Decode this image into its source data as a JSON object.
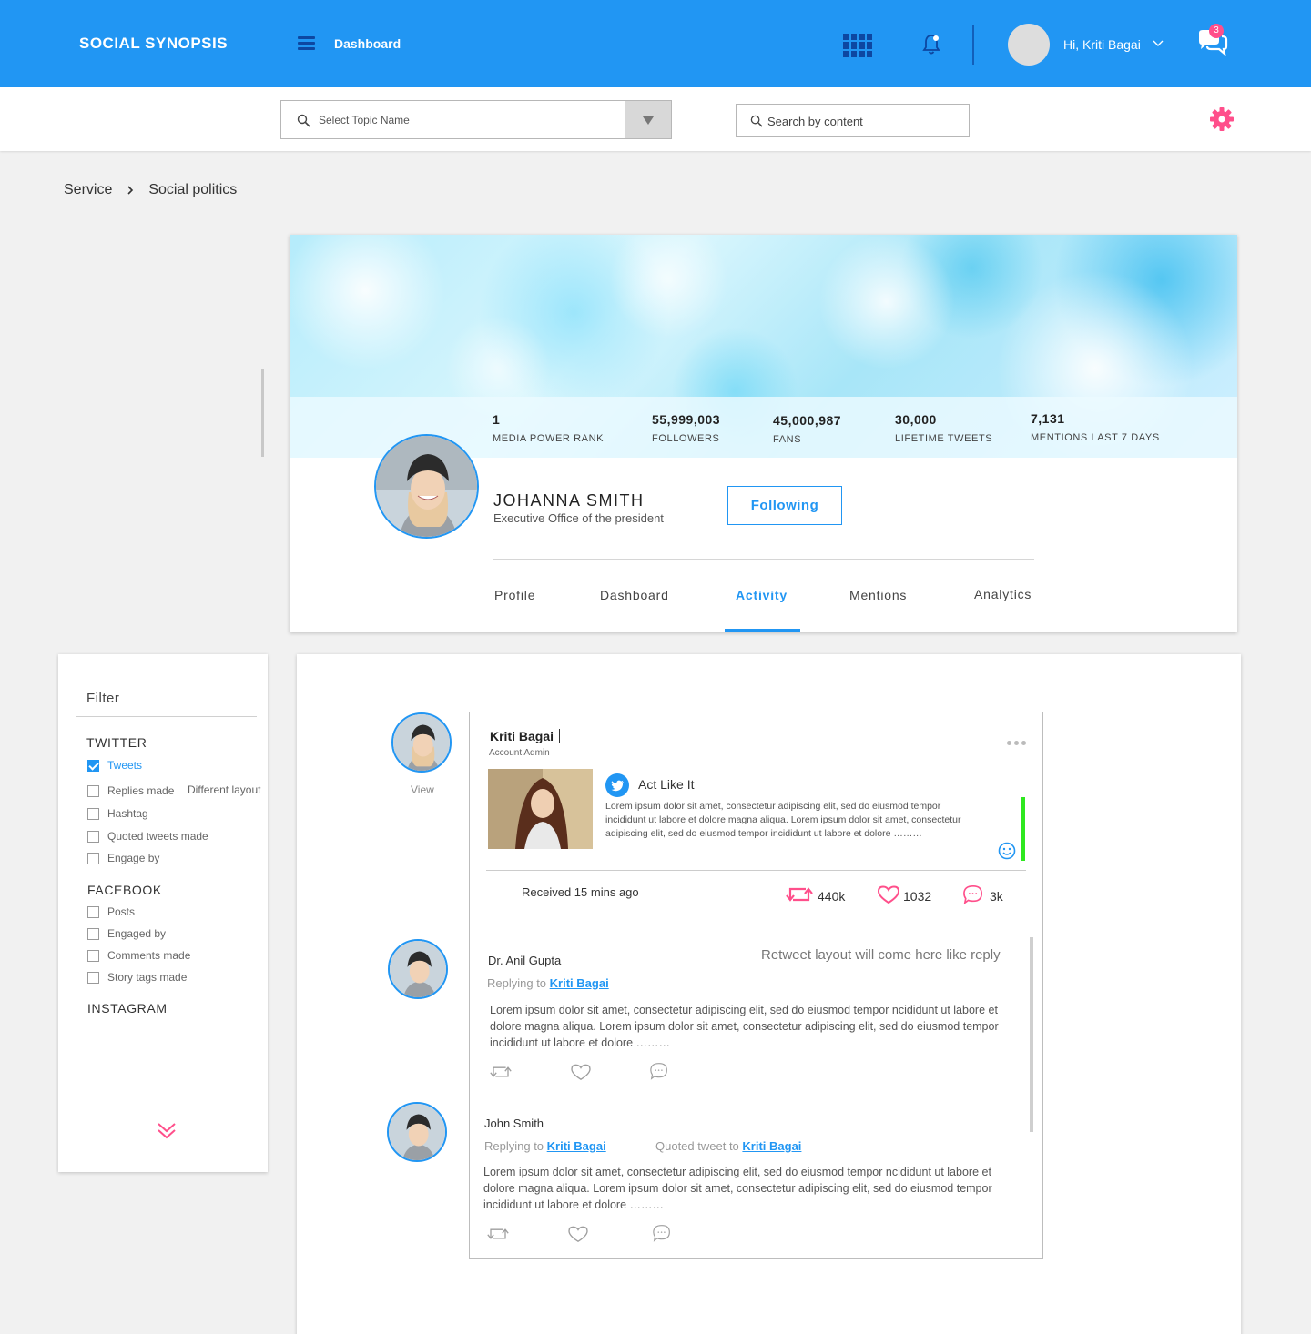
{
  "header": {
    "brand": "SOCIAL SYNOPSIS",
    "nav_label": "Dashboard",
    "greeting": "Hi, Kriti Bagai",
    "chat_badge": "3",
    "accent_color": "#2196f3",
    "icons": [
      "menu-icon",
      "apps-grid-icon",
      "bell-icon",
      "chevron-down-icon",
      "chat-icon"
    ]
  },
  "toolbar": {
    "topic_placeholder": "Select Topic Name",
    "content_placeholder": "Search by content",
    "icons": [
      "search-icon",
      "dropdown-arrow-icon",
      "gear-icon"
    ]
  },
  "breadcrumb": {
    "root": "Service",
    "current": "Social politics"
  },
  "profile": {
    "stats": [
      {
        "value": "1",
        "label": "MEDIA POWER RANK"
      },
      {
        "value": "55,999,003",
        "label": "FOLLOWERS"
      },
      {
        "value": "45,000,987",
        "label": "FANS"
      },
      {
        "value": "30,000",
        "label": "LIFETIME TWEETS"
      },
      {
        "value": "7,131",
        "label": "MENTIONS LAST 7 DAYS"
      }
    ],
    "name": "JOHANNA SMITH",
    "subtitle": "Executive Office of the president",
    "follow_label": "Following",
    "tabs": [
      "Profile",
      "Dashboard",
      "Activity",
      "Mentions",
      "Analytics"
    ],
    "active_tab": "Activity"
  },
  "filter": {
    "title": "Filter",
    "twitter": {
      "heading": "TWITTER",
      "items": [
        {
          "label": "Tweets",
          "checked": true
        },
        {
          "label": "Replies made",
          "checked": false
        },
        {
          "label": "Hashtag",
          "checked": false
        },
        {
          "label": "Quoted tweets made",
          "checked": false
        },
        {
          "label": "Engage by",
          "checked": false
        }
      ],
      "note": "Different layout"
    },
    "facebook": {
      "heading": "FACEBOOK",
      "items": [
        {
          "label": "Posts",
          "checked": false
        },
        {
          "label": "Engaged by",
          "checked": false
        },
        {
          "label": "Comments made",
          "checked": false
        },
        {
          "label": "Story tags made",
          "checked": false
        }
      ]
    },
    "instagram": {
      "heading": "INSTAGRAM"
    },
    "more_color": "#ff4f8b"
  },
  "feed": {
    "view_label": "View",
    "post": {
      "author": "Kriti Bagai",
      "role": "Account Admin",
      "title": "Act Like It",
      "body": "Lorem ipsum dolor sit amet, consectetur adipiscing elit, sed  do eiusmod tempor incididunt  ut labore et dolore magna aliqua. Lorem ipsum dolor sit amet, consectetur adipiscing elit, sed  do eiusmod tempor incididunt  ut labore et dolore ………",
      "received": "Received 15 mins ago",
      "retweets": "440k",
      "likes": "1032",
      "comments": "3k",
      "stat_color": "#ff4f8b"
    },
    "retweet_note": "Retweet layout will come here like reply",
    "replies": [
      {
        "name": "Dr. Anil Gupta",
        "replying_prefix": "Replying to",
        "replying_to": "Kriti Bagai",
        "body": "Lorem ipsum dolor sit amet, consectetur adipiscing elit, sed  do eiusmod tempor ncididunt  ut labore et dolore magna aliqua. Lorem ipsum dolor sit amet, consectetur adipiscing elit, sed  do eiusmod tempor incididunt  ut labore et dolore ………"
      },
      {
        "name": "John Smith",
        "replying_prefix": "Replying to",
        "replying_to": "Kriti Bagai",
        "quoted_prefix": "Quoted tweet to",
        "quoted_to": "Kriti Bagai",
        "body": "Lorem ipsum dolor sit amet, consectetur adipiscing elit, sed  do eiusmod tempor ncididunt  ut labore et dolore magna aliqua. Lorem ipsum dolor sit amet, consectetur adipiscing elit, sed  do eiusmod tempor incididunt  ut labore et dolore ………"
      }
    ]
  }
}
